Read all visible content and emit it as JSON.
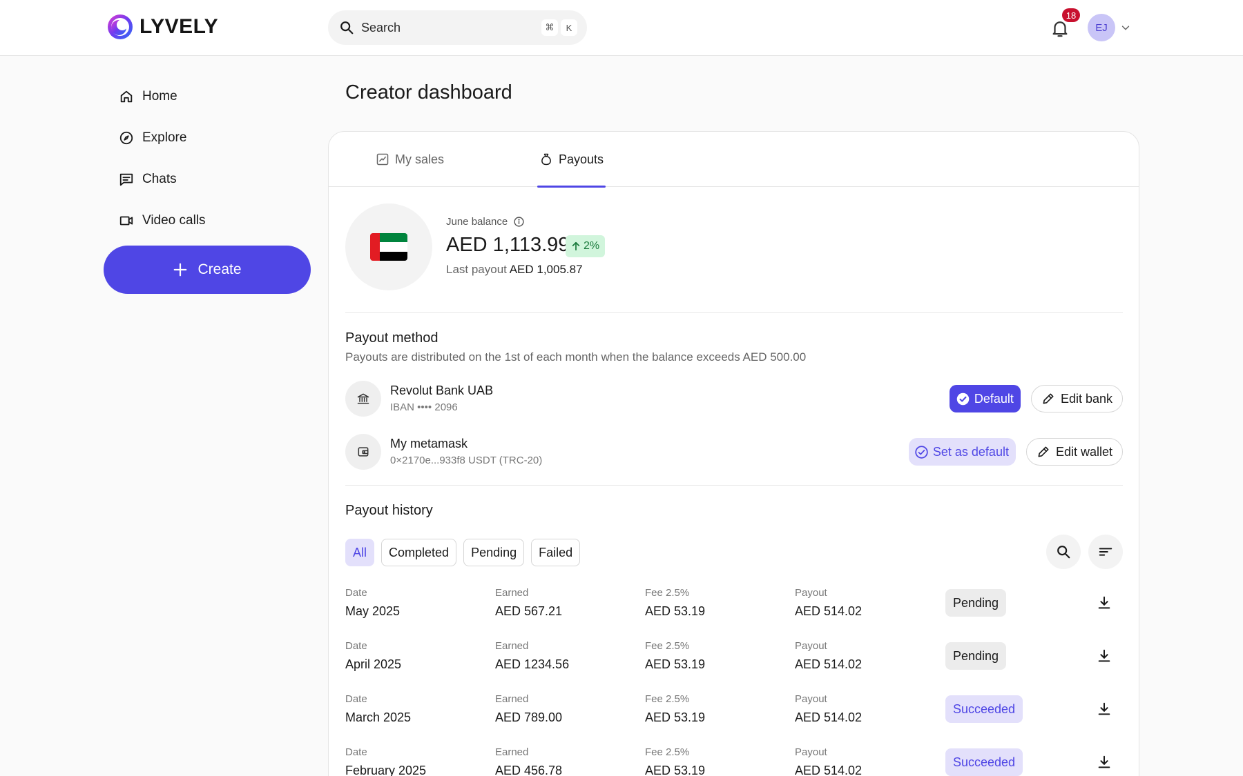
{
  "brand": {
    "name": "LYVELY",
    "accent": "#4f46e5"
  },
  "search": {
    "placeholder": "Search",
    "shortcut_mod": "⌘",
    "shortcut_key": "K"
  },
  "notifications": {
    "count": "18"
  },
  "user": {
    "initials": "EJ"
  },
  "sidebar": {
    "items": [
      {
        "label": "Home",
        "icon": "home-icon"
      },
      {
        "label": "Explore",
        "icon": "compass-icon"
      },
      {
        "label": "Chats",
        "icon": "chat-icon"
      },
      {
        "label": "Video calls",
        "icon": "video-icon"
      }
    ],
    "create_label": "Create"
  },
  "page": {
    "title": "Creator dashboard"
  },
  "tabs": [
    {
      "label": "My sales",
      "icon": "chart-icon"
    },
    {
      "label": "Payouts",
      "icon": "money-bag-icon",
      "active": true
    }
  ],
  "balance": {
    "label": "June balance",
    "amount": "AED 1,113.99",
    "change": "2%",
    "last_payout_label": "Last payout",
    "last_payout_value": "AED 1,005.87"
  },
  "payout_method": {
    "title": "Payout method",
    "subtitle": "Payouts are distributed on the 1st of each month when the balance exceeds AED 500.00",
    "methods": [
      {
        "name": "Revolut Bank UAB",
        "detail": "IBAN •••• 2096",
        "icon": "bank-icon",
        "primary_action": "Default",
        "edit_action": "Edit bank"
      },
      {
        "name": "My metamask",
        "detail": "0×2170e...933f8 USDT (TRC-20)",
        "icon": "wallet-icon",
        "primary_action": "Set as default",
        "edit_action": "Edit wallet"
      }
    ]
  },
  "payout_history": {
    "title": "Payout history",
    "filters": [
      "All",
      "Completed",
      "Pending",
      "Failed"
    ],
    "active_filter": "All",
    "columns": {
      "date": "Date",
      "earned": "Earned",
      "fee": "Fee 2.5%",
      "payout": "Payout"
    },
    "rows": [
      {
        "date": "May 2025",
        "earned": "AED 567.21",
        "fee": "AED 53.19",
        "payout": "AED 514.02",
        "status": "Pending"
      },
      {
        "date": "April 2025",
        "earned": "AED 1234.56",
        "fee": "AED 53.19",
        "payout": "AED 514.02",
        "status": "Pending"
      },
      {
        "date": "March 2025",
        "earned": "AED 789.00",
        "fee": "AED 53.19",
        "payout": "AED 514.02",
        "status": "Succeeded"
      },
      {
        "date": "February 2025",
        "earned": "AED 456.78",
        "fee": "AED 53.19",
        "payout": "AED 514.02",
        "status": "Succeeded"
      }
    ]
  }
}
